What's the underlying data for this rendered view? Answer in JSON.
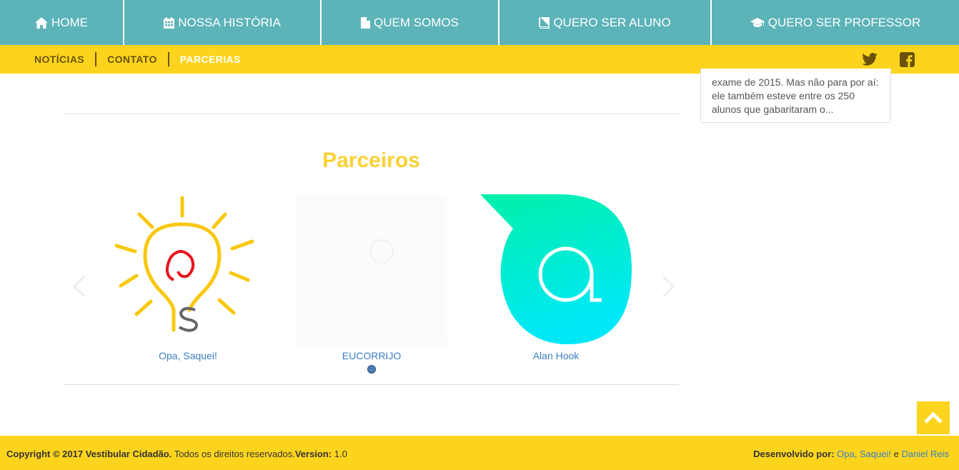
{
  "topnav": [
    {
      "label": "HOME",
      "icon": "home-icon"
    },
    {
      "label": "NOSSA HISTÓRIA",
      "icon": "calendar-icon"
    },
    {
      "label": "QUEM SOMOS",
      "icon": "file-icon"
    },
    {
      "label": "QUERO SER ALUNO",
      "icon": "book-icon"
    },
    {
      "label": "QUERO SER PROFESSOR",
      "icon": "graduation-cap-icon"
    }
  ],
  "subnav": [
    {
      "label": "NOTÍCIAS"
    },
    {
      "label": "CONTATO"
    },
    {
      "label": "PARCERIAS",
      "active": true
    }
  ],
  "social": [
    "twitter-icon",
    "facebook-icon"
  ],
  "news_card": {
    "excerpt": "exame de 2015. Mas não para por aí: ele também esteve entre os 250 alunos que gabaritaram o..."
  },
  "partners": {
    "title": "Parceiros",
    "items": [
      {
        "name": "Opa, Saquei!"
      },
      {
        "name": "EUCORRIJO"
      },
      {
        "name": "Alan Hook"
      }
    ]
  },
  "footer": {
    "copyright_bold": "Copyright © 2017 Vestibular Cidadão.",
    "rights": " Todos os direitos reservados.",
    "version_label": "Version:",
    "version_value": " 1.0",
    "dev_label": "Desenvolvido por:",
    "dev_link1": "Opa, Saquei!",
    "dev_and": " e ",
    "dev_link2": "Daniel Reis"
  },
  "colors": {
    "nav_teal": "#5cb3b8",
    "accent_yellow": "#fcd41d",
    "title_yellow": "#fcd133",
    "link_blue": "#3b7fc4"
  }
}
